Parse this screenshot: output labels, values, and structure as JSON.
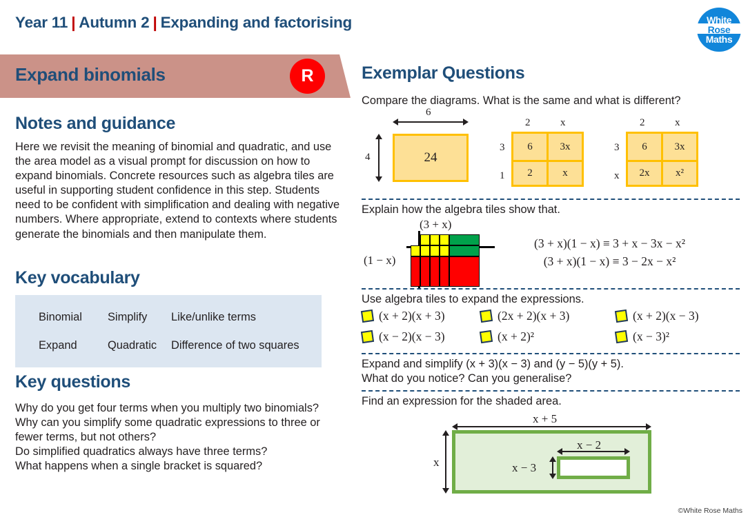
{
  "header": {
    "year": "Year 11",
    "term": "Autumn 2",
    "topic": "Expanding and factorising",
    "separator": "|",
    "logo": {
      "line1": "White",
      "line2": "Rose",
      "line3": "Maths"
    }
  },
  "banner": {
    "title": "Expand binomials",
    "badge": "R",
    "banner_color": "#cb9288",
    "badge_color": "#fe0000",
    "title_color": "#1f4e79"
  },
  "notes": {
    "heading": "Notes and guidance",
    "body": "Here we revisit the meaning of binomial and quadratic, and use the area model as a visual prompt for discussion on how to expand binomials. Concrete resources such as algebra tiles are useful in supporting student confidence in this step. Students need to be confident with simplification and dealing with negative numbers. Where appropriate, extend to contexts where students generate the binomials and then manipulate them."
  },
  "vocabulary": {
    "heading": "Key vocabulary",
    "box_color": "#dce6f1",
    "rows": [
      [
        "Binomial",
        "Simplify",
        "Like/unlike terms"
      ],
      [
        "Expand",
        "Quadratic",
        "Difference of two squares"
      ]
    ]
  },
  "key_questions": {
    "heading": "Key questions",
    "items": [
      "Why do you get four terms when you multiply two binomials?",
      "Why can you simplify some quadratic expressions to three or fewer terms, but not others?",
      "Do simplified quadratics always have three terms?",
      "What happens when a single bracket is squared?"
    ]
  },
  "exemplar": {
    "heading": "Exemplar Questions",
    "q1": "Compare the diagrams. What is the same and what is different?",
    "q2": "Explain how the algebra tiles show that.",
    "q3": "Use algebra tiles to expand the expressions.",
    "q4_line1": "Expand and simplify (x + 3)(x − 3) and (y − 5)(y + 5).",
    "q4_line2": "What do you notice? Can you generalise?",
    "q5": "Find an expression for the shaded area."
  },
  "area_models": {
    "fill": "#fde096",
    "stroke": "#ffc000",
    "model1": {
      "top_label": "6",
      "side_label": "4",
      "value": "24"
    },
    "model2": {
      "col_labels": [
        "2",
        "x"
      ],
      "row_labels": [
        "3",
        "1"
      ],
      "cells": [
        [
          "6",
          "3x"
        ],
        [
          "2",
          "x"
        ]
      ]
    },
    "model3": {
      "col_labels": [
        "2",
        "x"
      ],
      "row_labels": [
        "3",
        "x"
      ],
      "cells": [
        [
          "6",
          "3x"
        ],
        [
          "2x",
          "x²"
        ]
      ]
    }
  },
  "algebra_tiles": {
    "top_label": "(3 + x)",
    "side_label": "(1 − x)",
    "equation_line1": "(3 + x)(1 − x) ≡ 3 + x − 3x − x²",
    "equation_line2": "(3 + x)(1 − x) ≡ 3 − 2x − x²",
    "colors": {
      "unit": "#ffff00",
      "x_tile": "#00a14b",
      "negative": "#ff0000"
    }
  },
  "expressions": {
    "bullet_fill": "#ffff00",
    "bullet_stroke": "#1f3864",
    "rows": [
      [
        "(x + 2)(x + 3)",
        "(2x + 2)(x + 3)",
        "(x + 2)(x − 3)"
      ],
      [
        "(x − 2)(x − 3)",
        "(x + 2)²",
        "(x − 3)²"
      ]
    ]
  },
  "shaded_area": {
    "outer_width_label": "x + 5",
    "outer_height_label": "x",
    "inner_width_label": "x − 2",
    "inner_height_label": "x − 3",
    "fill": "#e2efd9",
    "stroke": "#70ad47"
  },
  "footer": {
    "copyright": "©White Rose Maths"
  }
}
